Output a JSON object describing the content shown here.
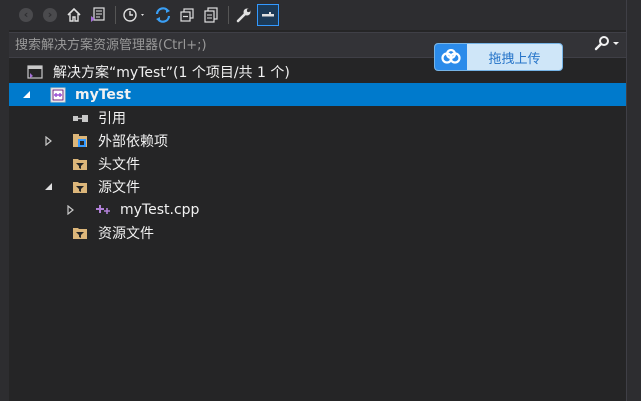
{
  "search": {
    "placeholder": "搜索解决方案资源管理器(Ctrl+;)"
  },
  "upload": {
    "label": "拖拽上传"
  },
  "tree": {
    "solution": "解决方案“myTest”(1 个项目/共 1 个)",
    "project": "myTest",
    "references": "引用",
    "external_deps": "外部依赖项",
    "header_files": "头文件",
    "source_files": "源文件",
    "source_file_item": "myTest.cpp",
    "resource_files": "资源文件"
  },
  "icons": {
    "back": "back-arrow-icon",
    "forward": "forward-arrow-icon",
    "home": "home-icon",
    "vs": "visual-studio-icon",
    "history": "history-icon",
    "sync": "sync-icon",
    "collapse": "collapse-all-icon",
    "copy": "show-all-files-icon",
    "properties": "wrench-icon",
    "preview": "preview-selected-icon",
    "search": "search-icon"
  },
  "colors": {
    "selection": "#007acc",
    "accent": "#3399ff",
    "folder": "#dcb67a"
  }
}
